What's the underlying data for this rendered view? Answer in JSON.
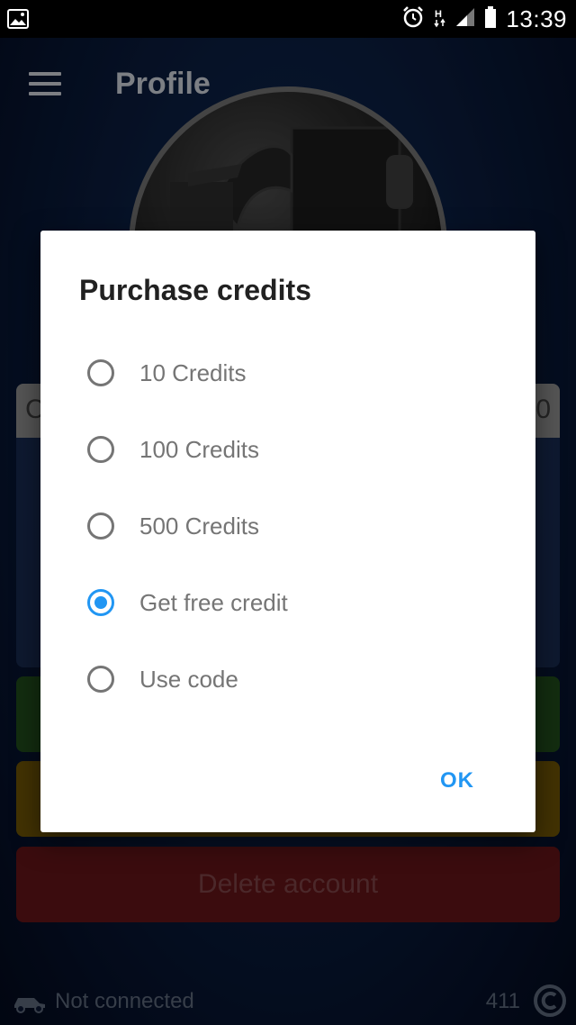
{
  "status_bar": {
    "time": "13:39",
    "icons": [
      "image-icon",
      "alarm-icon",
      "h-plus-signal-icon",
      "signal-icon",
      "battery-icon"
    ]
  },
  "app_bar": {
    "title": "Profile",
    "menu_icon": "hamburger-menu-icon"
  },
  "background": {
    "card_header_left": "C",
    "card_header_right": "0",
    "delete_button_label": "Delete account",
    "connection_status": "Not connected",
    "credits_count": "411"
  },
  "dialog": {
    "title": "Purchase credits",
    "options": [
      {
        "label": "10 Credits",
        "checked": false
      },
      {
        "label": "100 Credits",
        "checked": false
      },
      {
        "label": "500 Credits",
        "checked": false
      },
      {
        "label": "Get free credit",
        "checked": true
      },
      {
        "label": "Use code",
        "checked": false
      }
    ],
    "ok_label": "OK"
  },
  "colors": {
    "accent": "#2196f3",
    "dialog_bg": "#ffffff",
    "delete_red": "#5f1417"
  }
}
